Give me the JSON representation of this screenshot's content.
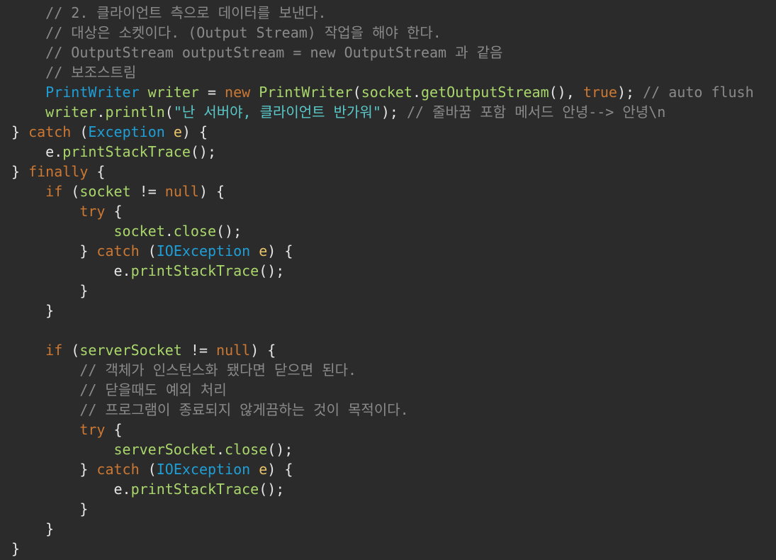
{
  "editor": {
    "background": "#2b2b2b",
    "lines": [
      {
        "indent": 4,
        "tokens": [
          {
            "t": "// 2. 클라이언트 측으로 데이터를 보낸다.",
            "c": "comment"
          }
        ]
      },
      {
        "indent": 4,
        "tokens": [
          {
            "t": "// 대상은 소켓이다. (Output Stream) 작업을 해야 한다.",
            "c": "comment"
          }
        ]
      },
      {
        "indent": 4,
        "tokens": [
          {
            "t": "// OutputStream outputStream = new OutputStream 과 같음",
            "c": "comment"
          }
        ]
      },
      {
        "indent": 4,
        "tokens": [
          {
            "t": "// 보조스트림",
            "c": "comment"
          }
        ]
      },
      {
        "indent": 4,
        "tokens": [
          {
            "t": "PrintWriter",
            "c": "type"
          },
          {
            "t": " ",
            "c": "plain"
          },
          {
            "t": "writer",
            "c": "var"
          },
          {
            "t": " = ",
            "c": "plain"
          },
          {
            "t": "new",
            "c": "kw"
          },
          {
            "t": " ",
            "c": "plain"
          },
          {
            "t": "PrintWriter",
            "c": "method"
          },
          {
            "t": "(",
            "c": "punc"
          },
          {
            "t": "socket",
            "c": "var"
          },
          {
            "t": ".",
            "c": "punc"
          },
          {
            "t": "getOutputStream",
            "c": "method"
          },
          {
            "t": "(), ",
            "c": "punc"
          },
          {
            "t": "true",
            "c": "kw"
          },
          {
            "t": "); ",
            "c": "punc"
          },
          {
            "t": "// auto flush",
            "c": "comment"
          }
        ]
      },
      {
        "indent": 4,
        "tokens": [
          {
            "t": "writer",
            "c": "var"
          },
          {
            "t": ".",
            "c": "punc"
          },
          {
            "t": "println",
            "c": "method"
          },
          {
            "t": "(",
            "c": "punc"
          },
          {
            "t": "\"난 서버야, 클라이언트 반가워\"",
            "c": "str"
          },
          {
            "t": "); ",
            "c": "punc"
          },
          {
            "t": "// 줄바꿈 포함 메서드 안녕--> 안녕\\n",
            "c": "comment"
          }
        ]
      },
      {
        "indent": 0,
        "tokens": [
          {
            "t": "} ",
            "c": "punc"
          },
          {
            "t": "catch",
            "c": "kw"
          },
          {
            "t": " (",
            "c": "punc"
          },
          {
            "t": "Exception",
            "c": "type"
          },
          {
            "t": " ",
            "c": "plain"
          },
          {
            "t": "e",
            "c": "param"
          },
          {
            "t": ") {",
            "c": "punc"
          }
        ]
      },
      {
        "indent": 4,
        "tokens": [
          {
            "t": "e",
            "c": "plain"
          },
          {
            "t": ".",
            "c": "punc"
          },
          {
            "t": "printStackTrace",
            "c": "method"
          },
          {
            "t": "();",
            "c": "punc"
          }
        ]
      },
      {
        "indent": 0,
        "tokens": [
          {
            "t": "} ",
            "c": "punc"
          },
          {
            "t": "finally",
            "c": "kw"
          },
          {
            "t": " {",
            "c": "punc"
          }
        ]
      },
      {
        "indent": 4,
        "tokens": [
          {
            "t": "if",
            "c": "kw"
          },
          {
            "t": " (",
            "c": "punc"
          },
          {
            "t": "socket",
            "c": "var"
          },
          {
            "t": " != ",
            "c": "plain"
          },
          {
            "t": "null",
            "c": "kw"
          },
          {
            "t": ") {",
            "c": "punc"
          }
        ]
      },
      {
        "indent": 8,
        "tokens": [
          {
            "t": "try",
            "c": "kw"
          },
          {
            "t": " {",
            "c": "punc"
          }
        ]
      },
      {
        "indent": 12,
        "tokens": [
          {
            "t": "socket",
            "c": "var"
          },
          {
            "t": ".",
            "c": "punc"
          },
          {
            "t": "close",
            "c": "method"
          },
          {
            "t": "();",
            "c": "punc"
          }
        ]
      },
      {
        "indent": 8,
        "tokens": [
          {
            "t": "} ",
            "c": "punc"
          },
          {
            "t": "catch",
            "c": "kw"
          },
          {
            "t": " (",
            "c": "punc"
          },
          {
            "t": "IOException",
            "c": "type"
          },
          {
            "t": " ",
            "c": "plain"
          },
          {
            "t": "e",
            "c": "param"
          },
          {
            "t": ") {",
            "c": "punc"
          }
        ]
      },
      {
        "indent": 12,
        "tokens": [
          {
            "t": "e",
            "c": "plain"
          },
          {
            "t": ".",
            "c": "punc"
          },
          {
            "t": "printStackTrace",
            "c": "method"
          },
          {
            "t": "();",
            "c": "punc"
          }
        ]
      },
      {
        "indent": 8,
        "tokens": [
          {
            "t": "}",
            "c": "punc"
          }
        ]
      },
      {
        "indent": 4,
        "tokens": [
          {
            "t": "}",
            "c": "punc"
          }
        ]
      },
      {
        "indent": 0,
        "tokens": []
      },
      {
        "indent": 4,
        "tokens": [
          {
            "t": "if",
            "c": "kw"
          },
          {
            "t": " (",
            "c": "punc"
          },
          {
            "t": "serverSocket",
            "c": "var"
          },
          {
            "t": " != ",
            "c": "plain"
          },
          {
            "t": "null",
            "c": "kw"
          },
          {
            "t": ") {",
            "c": "punc"
          }
        ]
      },
      {
        "indent": 8,
        "tokens": [
          {
            "t": "// 객체가 인스턴스화 됐다면 닫으면 된다.",
            "c": "comment"
          }
        ]
      },
      {
        "indent": 8,
        "tokens": [
          {
            "t": "// 닫을때도 예외 처리",
            "c": "comment"
          }
        ]
      },
      {
        "indent": 8,
        "tokens": [
          {
            "t": "// 프로그램이 종료되지 않게끔하는 것이 목적이다.",
            "c": "comment"
          }
        ]
      },
      {
        "indent": 8,
        "tokens": [
          {
            "t": "try",
            "c": "kw"
          },
          {
            "t": " {",
            "c": "punc"
          }
        ]
      },
      {
        "indent": 12,
        "tokens": [
          {
            "t": "serverSocket",
            "c": "var"
          },
          {
            "t": ".",
            "c": "punc"
          },
          {
            "t": "close",
            "c": "method"
          },
          {
            "t": "();",
            "c": "punc"
          }
        ]
      },
      {
        "indent": 8,
        "tokens": [
          {
            "t": "} ",
            "c": "punc"
          },
          {
            "t": "catch",
            "c": "kw"
          },
          {
            "t": " (",
            "c": "punc"
          },
          {
            "t": "IOException",
            "c": "type"
          },
          {
            "t": " ",
            "c": "plain"
          },
          {
            "t": "e",
            "c": "param"
          },
          {
            "t": ") {",
            "c": "punc"
          }
        ]
      },
      {
        "indent": 12,
        "tokens": [
          {
            "t": "e",
            "c": "plain"
          },
          {
            "t": ".",
            "c": "punc"
          },
          {
            "t": "printStackTrace",
            "c": "method"
          },
          {
            "t": "();",
            "c": "punc"
          }
        ]
      },
      {
        "indent": 8,
        "tokens": [
          {
            "t": "}",
            "c": "punc"
          }
        ]
      },
      {
        "indent": 4,
        "tokens": [
          {
            "t": "}",
            "c": "punc"
          }
        ]
      },
      {
        "indent": 0,
        "tokens": [
          {
            "t": "}",
            "c": "punc"
          }
        ]
      }
    ]
  }
}
